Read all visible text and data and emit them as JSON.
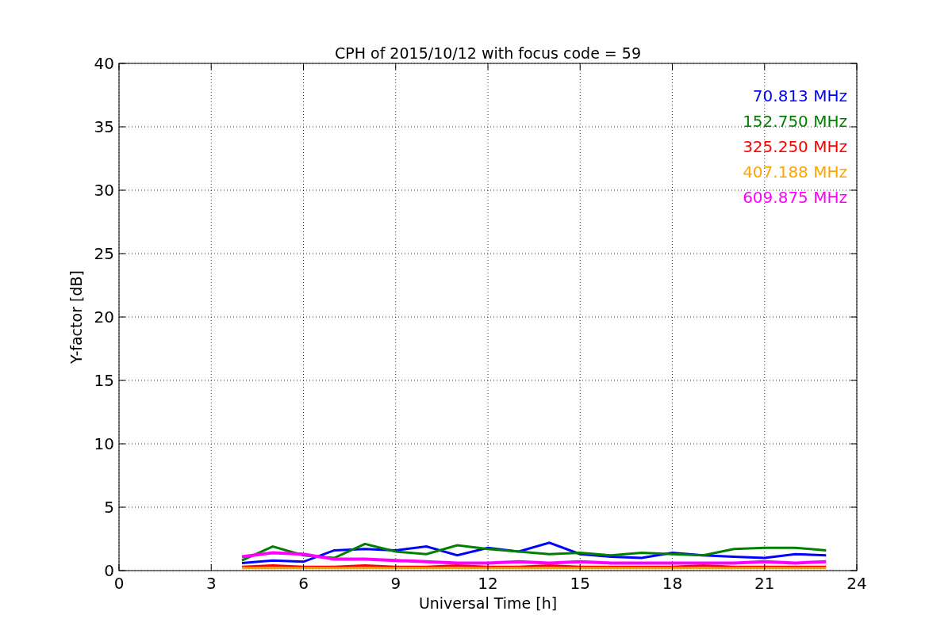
{
  "chart": {
    "chart_data": {
      "type": "line",
      "title": "CPH of 2015/10/12 with focus code = 59",
      "xlabel": "Universal Time [h]",
      "ylabel": "Y-factor [dB]",
      "x": [
        4,
        5,
        6,
        7,
        8,
        9,
        10,
        11,
        12,
        13,
        14,
        15,
        16,
        17,
        18,
        19,
        20,
        21,
        22,
        23
      ],
      "series": [
        {
          "name": "70.813 MHz",
          "color": "#0000ff",
          "values": [
            0.6,
            0.8,
            0.7,
            1.6,
            1.7,
            1.6,
            1.9,
            1.2,
            1.8,
            1.5,
            2.2,
            1.3,
            1.1,
            1.0,
            1.4,
            1.2,
            1.1,
            1.0,
            1.3,
            1.2
          ]
        },
        {
          "name": "152.750 MHz",
          "color": "#008000",
          "values": [
            0.8,
            1.9,
            1.2,
            1.0,
            2.1,
            1.5,
            1.3,
            2.0,
            1.7,
            1.5,
            1.3,
            1.4,
            1.2,
            1.4,
            1.3,
            1.2,
            1.7,
            1.8,
            1.8,
            1.6
          ]
        },
        {
          "name": "325.250 MHz",
          "color": "#ff0000",
          "values": [
            0.3,
            0.4,
            0.3,
            0.3,
            0.4,
            0.3,
            0.3,
            0.4,
            0.3,
            0.3,
            0.4,
            0.3,
            0.3,
            0.3,
            0.3,
            0.4,
            0.3,
            0.3,
            0.3,
            0.3
          ]
        },
        {
          "name": "407.188 MHz",
          "color": "#ffa500",
          "values": [
            0.2,
            0.2,
            0.2,
            0.2,
            0.2,
            0.2,
            0.2,
            0.2,
            0.2,
            0.2,
            0.2,
            0.2,
            0.2,
            0.2,
            0.2,
            0.2,
            0.2,
            0.2,
            0.2,
            0.2
          ]
        },
        {
          "name": "609.875 MHz",
          "color": "#ff00ff",
          "values": [
            1.1,
            1.4,
            1.3,
            0.9,
            0.9,
            0.8,
            0.7,
            0.6,
            0.6,
            0.7,
            0.6,
            0.7,
            0.6,
            0.6,
            0.6,
            0.6,
            0.6,
            0.7,
            0.6,
            0.7
          ]
        }
      ],
      "xlim": [
        0,
        24
      ],
      "ylim": [
        0,
        40
      ],
      "xticks": [
        0,
        3,
        6,
        9,
        12,
        15,
        18,
        21,
        24
      ],
      "yticks": [
        0,
        5,
        10,
        15,
        20,
        25,
        30,
        35,
        40
      ],
      "grid": true
    }
  }
}
